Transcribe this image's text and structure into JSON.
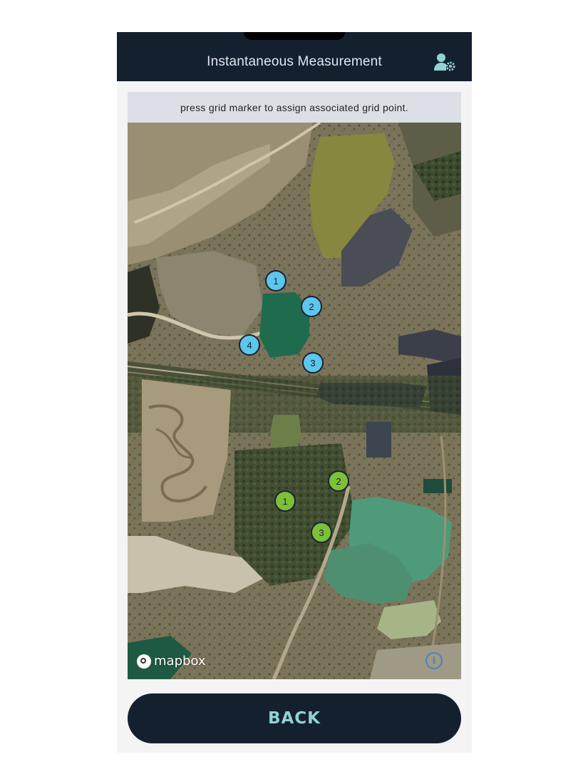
{
  "header": {
    "title": "Instantaneous Measurement",
    "settings_icon": "user-settings-icon"
  },
  "hint": {
    "text": "press grid marker to assign associated grid point."
  },
  "map": {
    "attribution": "mapbox",
    "info_icon": "info-icon",
    "info_glyph": "i",
    "blue_markers": [
      {
        "label": "1"
      },
      {
        "label": "2"
      },
      {
        "label": "3"
      },
      {
        "label": "4"
      }
    ],
    "green_markers": [
      {
        "label": "1"
      },
      {
        "label": "2"
      },
      {
        "label": "3"
      }
    ],
    "colors": {
      "blue_marker": "#5cc6ec",
      "green_marker": "#7cc03a"
    }
  },
  "footer": {
    "back_label": "BACK"
  },
  "colors": {
    "header_bg": "#15202f",
    "button_text": "#8fd3d3"
  }
}
